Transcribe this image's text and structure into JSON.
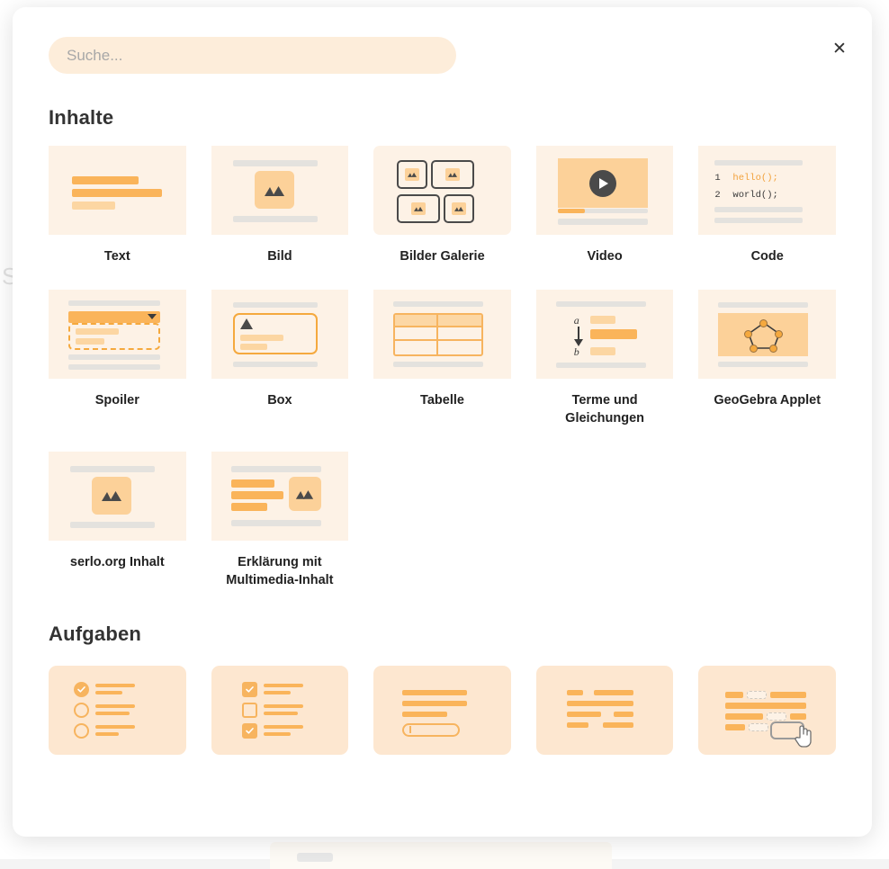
{
  "modal": {
    "close_label": "✕",
    "close_icon": "close-icon"
  },
  "search": {
    "placeholder": "Suche...",
    "value": ""
  },
  "sections": [
    {
      "id": "inhalte",
      "title": "Inhalte",
      "rows": [
        [
          {
            "id": "text",
            "label": "Text"
          },
          {
            "id": "bild",
            "label": "Bild"
          },
          {
            "id": "bilder-galerie",
            "label": "Bilder Galerie"
          },
          {
            "id": "video",
            "label": "Video"
          },
          {
            "id": "code",
            "label": "Code"
          }
        ],
        [
          {
            "id": "spoiler",
            "label": "Spoiler"
          },
          {
            "id": "box",
            "label": "Box"
          },
          {
            "id": "tabelle",
            "label": "Tabelle"
          },
          {
            "id": "terme-und-gleichungen",
            "label": "Terme und Gleichungen"
          },
          {
            "id": "geogebra-applet",
            "label": "GeoGebra Applet"
          }
        ],
        [
          {
            "id": "serlo-org-inhalt",
            "label": "serlo.org Inhalt"
          },
          {
            "id": "erklaerung-multimedia",
            "label": "Erklärung mit Multimedia-Inhalt"
          }
        ]
      ]
    },
    {
      "id": "aufgaben",
      "title": "Aufgaben",
      "rows": [
        [
          {
            "id": "aufgabe-single-choice",
            "label": ""
          },
          {
            "id": "aufgabe-multiple-choice",
            "label": ""
          },
          {
            "id": "aufgabe-eingabefeld",
            "label": ""
          },
          {
            "id": "aufgabe-text",
            "label": ""
          },
          {
            "id": "aufgabe-drag-drop",
            "label": ""
          }
        ]
      ]
    }
  ],
  "code_tile": {
    "line1_num": "1",
    "line1_text": "hello();",
    "line2_num": "2",
    "line2_text": "world();"
  },
  "terme_tile": {
    "letter_a": "a",
    "letter_b": "b"
  },
  "colors": {
    "tile_bg": "#fdf2e6",
    "tile_bg_alt": "#fde7d0",
    "orange": "#fab45a",
    "orange_light": "#fcd6a2",
    "orange_border": "#f5a93e",
    "gray_line": "#e4e2de",
    "dark": "#3b3b3b",
    "search_bg": "#fdedda",
    "modal_bg": "#ffffff"
  }
}
